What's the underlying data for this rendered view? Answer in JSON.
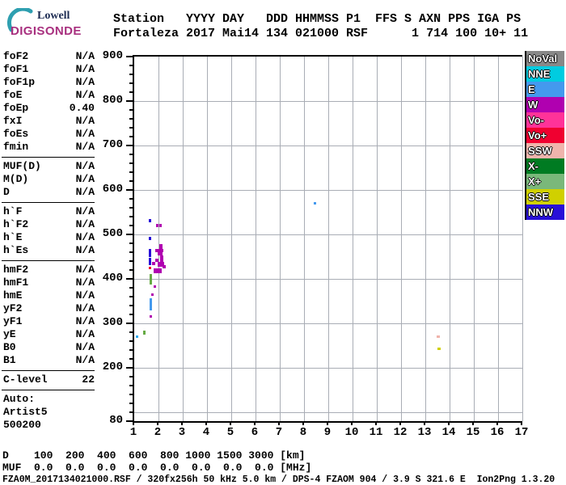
{
  "logo": {
    "line1": "Lowell",
    "line2": "DIGISONDE",
    "swoosh_color": "#2e9fb0",
    "brand_color": "#a8307f"
  },
  "header": {
    "line1": "Station   YYYY DAY   DDD HHMMSS P1  FFS S AXN PPS IGA PS",
    "line2": "Fortaleza 2017 Mai14 134 021000 RSF      1 714 100 10+ 11"
  },
  "params": {
    "groups": [
      [
        {
          "label": "foF2",
          "value": "N/A"
        },
        {
          "label": "foF1",
          "value": "N/A"
        },
        {
          "label": "foF1p",
          "value": "N/A"
        },
        {
          "label": "foE",
          "value": "N/A"
        },
        {
          "label": "foEp",
          "value": "0.40"
        },
        {
          "label": "fxI",
          "value": "N/A"
        },
        {
          "label": "foEs",
          "value": "N/A"
        },
        {
          "label": "fmin",
          "value": "N/A"
        }
      ],
      [
        {
          "label": "MUF(D)",
          "value": "N/A"
        },
        {
          "label": "M(D)",
          "value": "N/A"
        },
        {
          "label": "D",
          "value": "N/A"
        }
      ],
      [
        {
          "label": "h`F",
          "value": "N/A"
        },
        {
          "label": "h`F2",
          "value": "N/A"
        },
        {
          "label": "h`E",
          "value": "N/A"
        },
        {
          "label": "h`Es",
          "value": "N/A"
        }
      ],
      [
        {
          "label": "hmF2",
          "value": "N/A"
        },
        {
          "label": "hmF1",
          "value": "N/A"
        },
        {
          "label": "hmE",
          "value": "N/A"
        },
        {
          "label": "yF2",
          "value": "N/A"
        },
        {
          "label": "yF1",
          "value": "N/A"
        },
        {
          "label": "yE",
          "value": "N/A"
        },
        {
          "label": "B0",
          "value": "N/A"
        },
        {
          "label": "B1",
          "value": "N/A"
        }
      ],
      [
        {
          "label": "C-level",
          "value": "22"
        }
      ],
      [
        {
          "label": "Auto:",
          "value": ""
        },
        {
          "label": "Artist5",
          "value": ""
        },
        {
          "label": "500200",
          "value": ""
        }
      ]
    ]
  },
  "legend": {
    "items": [
      {
        "label": "NoVal",
        "color": "#888888"
      },
      {
        "label": "NNE",
        "color": "#00cce0"
      },
      {
        "label": "E",
        "color": "#4499ee"
      },
      {
        "label": "W",
        "color": "#b000b0"
      },
      {
        "label": "Vo-",
        "color": "#ff3399"
      },
      {
        "label": "Vo+",
        "color": "#f00030"
      },
      {
        "label": "SSW",
        "color": "#f0b4ac"
      },
      {
        "label": "X-",
        "color": "#007b22"
      },
      {
        "label": "X+",
        "color": "#7ab87a"
      },
      {
        "label": "SSE",
        "color": "#d0d000"
      },
      {
        "label": "NNW",
        "color": "#2810d8"
      }
    ]
  },
  "chart_data": {
    "type": "scatter",
    "x_unit": "MHz",
    "y_unit": "km",
    "x_range": [
      1,
      17
    ],
    "y_range": [
      80,
      900
    ],
    "x_tick_labels": [
      "1",
      "2",
      "3",
      "4",
      "5",
      "6",
      "7",
      "8",
      "9",
      "10",
      "11",
      "12",
      "13",
      "14",
      "15",
      "16",
      "17"
    ],
    "y_label_values": [
      900,
      800,
      700,
      600,
      500,
      400,
      300,
      200,
      80
    ],
    "y_minor_step_km": 20,
    "grid_x_values": [
      2,
      3,
      4,
      5,
      6,
      7,
      8,
      9,
      10,
      11,
      12,
      13,
      14,
      15,
      16,
      17
    ],
    "grid_y_values": [
      100,
      200,
      300,
      400,
      500,
      600,
      700,
      800
    ],
    "grid_color": "#a9adb5",
    "colors": {
      "NNW": "#2810d8",
      "W": "#b000b0",
      "Vo+": "#f00030",
      "E": "#4499ee",
      "NNE": "#33aaee",
      "X+": "#66aa44",
      "SSW": "#f0b4ac",
      "SSE": "#d0d000"
    },
    "points": [
      {
        "f": 1.6,
        "km": 535,
        "w": 3,
        "h": 4,
        "c": "NNW"
      },
      {
        "f": 1.9,
        "km": 524,
        "w": 3,
        "h": 4,
        "c": "W"
      },
      {
        "f": 2.03,
        "km": 524,
        "w": 3,
        "h": 4,
        "c": "W"
      },
      {
        "f": 1.6,
        "km": 495,
        "w": 3,
        "h": 4,
        "c": "NNW"
      },
      {
        "f": 1.6,
        "km": 467,
        "w": 3,
        "h": 10,
        "c": "NNW"
      },
      {
        "f": 1.6,
        "km": 447,
        "w": 3,
        "h": 9,
        "c": "NNW"
      },
      {
        "f": 2.03,
        "km": 478,
        "w": 4,
        "h": 8,
        "c": "W"
      },
      {
        "f": 1.87,
        "km": 467,
        "w": 10,
        "h": 4,
        "c": "W"
      },
      {
        "f": 1.97,
        "km": 460,
        "w": 6,
        "h": 4,
        "c": "W"
      },
      {
        "f": 2.07,
        "km": 453,
        "w": 4,
        "h": 8,
        "c": "W"
      },
      {
        "f": 1.87,
        "km": 445,
        "w": 4,
        "h": 4,
        "c": "W"
      },
      {
        "f": 1.73,
        "km": 438,
        "w": 4,
        "h": 4,
        "c": "W"
      },
      {
        "f": 1.97,
        "km": 438,
        "w": 8,
        "h": 6,
        "c": "W"
      },
      {
        "f": 2.17,
        "km": 431,
        "w": 4,
        "h": 4,
        "c": "W"
      },
      {
        "f": 1.8,
        "km": 424,
        "w": 10,
        "h": 6,
        "c": "W"
      },
      {
        "f": 1.6,
        "km": 427,
        "w": 3,
        "h": 3,
        "c": "Vo+"
      },
      {
        "f": 1.63,
        "km": 411,
        "w": 3,
        "h": 13,
        "c": "X+"
      },
      {
        "f": 1.8,
        "km": 385,
        "w": 3,
        "h": 3,
        "c": "W"
      },
      {
        "f": 1.7,
        "km": 367,
        "w": 3,
        "h": 3,
        "c": "W"
      },
      {
        "f": 1.63,
        "km": 356,
        "w": 3,
        "h": 15,
        "c": "E"
      },
      {
        "f": 1.63,
        "km": 318,
        "w": 3,
        "h": 3,
        "c": "W"
      },
      {
        "f": 1.37,
        "km": 284,
        "w": 3,
        "h": 5,
        "c": "X+"
      },
      {
        "f": 1.07,
        "km": 273,
        "w": 3,
        "h": 3,
        "c": "NNE"
      },
      {
        "f": 8.4,
        "km": 573,
        "w": 3,
        "h": 3,
        "c": "E"
      },
      {
        "f": 13.47,
        "km": 273,
        "w": 4,
        "h": 3,
        "c": "SSW"
      },
      {
        "f": 13.5,
        "km": 245,
        "w": 4,
        "h": 3,
        "c": "SSE"
      }
    ]
  },
  "bottom": {
    "d_line": "D    100  200  400  600  800 1000 1500 3000 [km]",
    "muf_line": "MUF  0.0  0.0  0.0  0.0  0.0  0.0  0.0  0.0 [MHz]",
    "footer": "FZA0M_2017134021000.RSF / 320fx256h 50 kHz 5.0 km / DPS-4 FZAOM 904 / 3.9 S 321.6 E  Ion2Png 1.3.20"
  }
}
